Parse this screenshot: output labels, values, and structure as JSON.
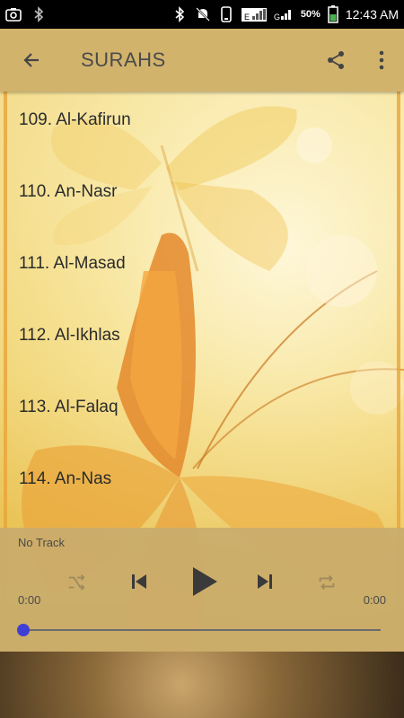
{
  "status_bar": {
    "battery_percent": "50%",
    "time": "12:43 AM",
    "icons": [
      "screenshot-icon",
      "bluetooth-icon",
      "bluetooth-icon",
      "mute-icon",
      "phone-icon",
      "signal-e-icon",
      "signal-g-icon",
      "battery-icon"
    ]
  },
  "app_bar": {
    "title": "SURAHS",
    "back_icon": "arrow-left-icon",
    "share_icon": "share-icon",
    "more_icon": "more-vert-icon",
    "color": "#d2b36c"
  },
  "list": {
    "items": [
      {
        "label": "109. Al-Kafirun"
      },
      {
        "label": "110. An-Nasr"
      },
      {
        "label": "111. Al-Masad"
      },
      {
        "label": "112. Al-Ikhlas"
      },
      {
        "label": "113. Al-Falaq"
      },
      {
        "label": "114. An-Nas"
      }
    ]
  },
  "player": {
    "track": "No Track",
    "current_time": "0:00",
    "total_time": "0:00",
    "progress": 0,
    "thumb_color": "#3f3fd6",
    "controls": [
      "shuffle-icon",
      "skip-previous-icon",
      "play-icon",
      "skip-next-icon",
      "repeat-icon"
    ]
  }
}
